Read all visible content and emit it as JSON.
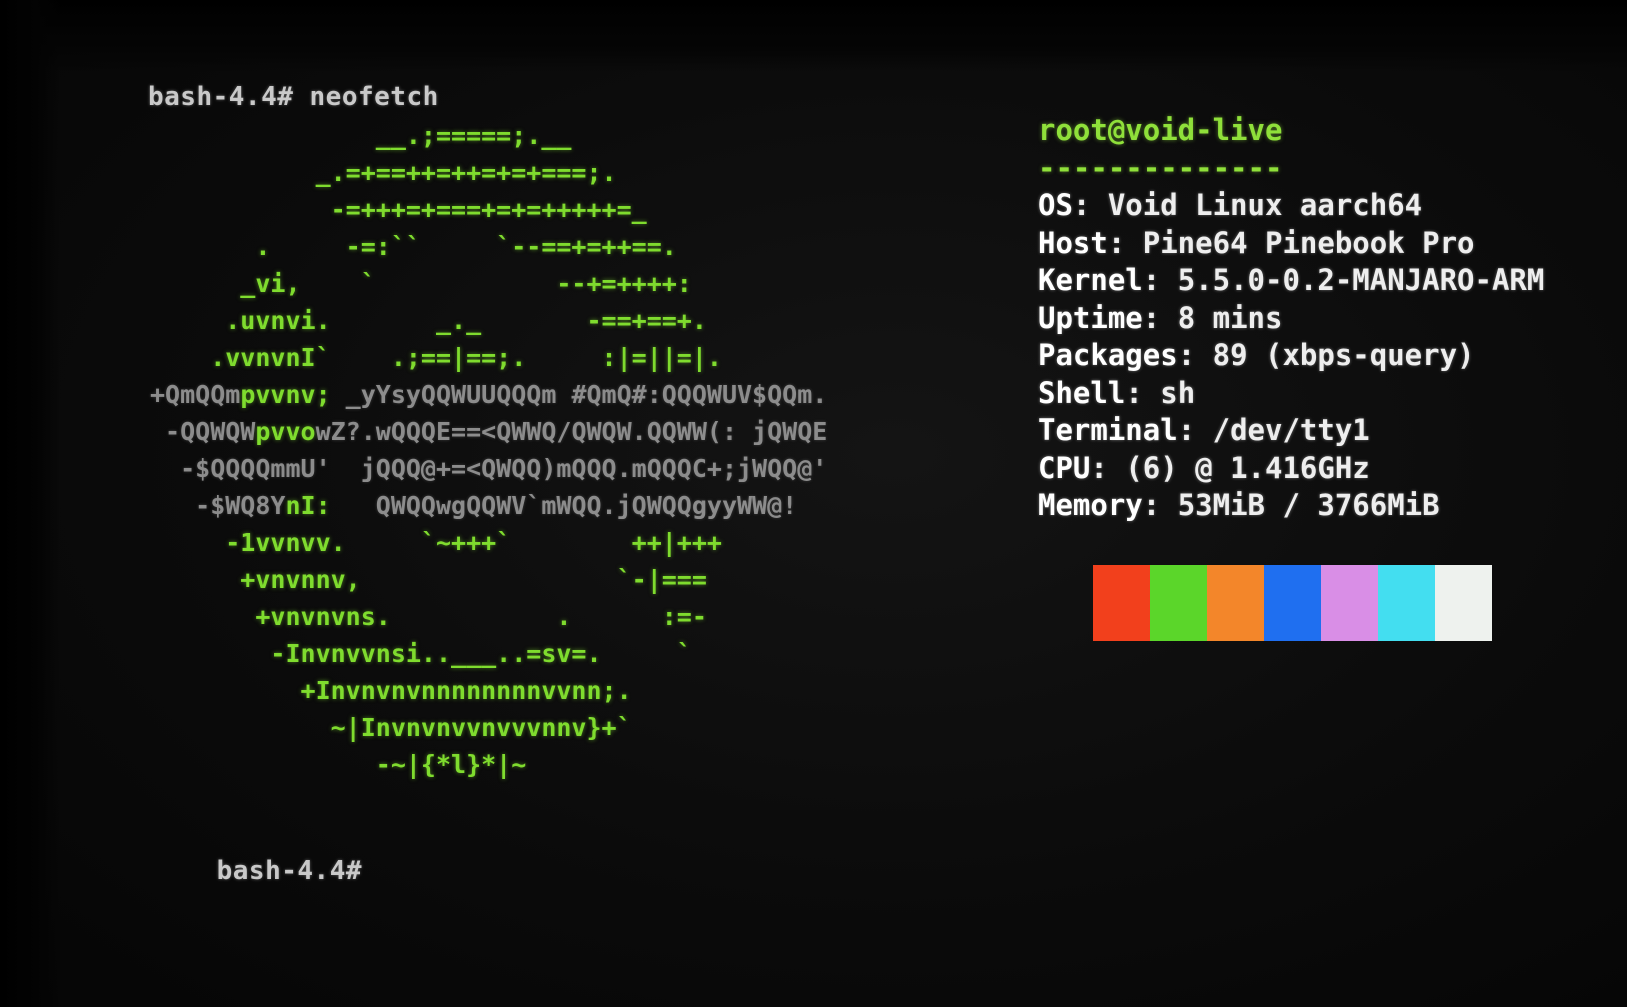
{
  "terminal": {
    "prompt_command": "bash-4.4# neofetch",
    "prompt_idle": "bash-4.4#"
  },
  "logo": {
    "lines": [
      [
        {
          "t": "               __.;=====;.__",
          "d": false
        }
      ],
      [
        {
          "t": "           _.=+==++=++=+=+===;.",
          "d": false
        }
      ],
      [
        {
          "t": "            -=+++=+===+=+=+++++=_",
          "d": false
        }
      ],
      [
        {
          "t": "       .     -=:``     `--==+=++==.",
          "d": false
        }
      ],
      [
        {
          "t": "      _vi,    `            --+=++++:",
          "d": false
        }
      ],
      [
        {
          "t": "     .uvnvi.       _._       -==+==+.",
          "d": false
        }
      ],
      [
        {
          "t": "    .vvnvnI`    .;==|==;.     :|=||=|.",
          "d": false
        }
      ],
      [
        {
          "t": "+QmQQm",
          "d": true
        },
        {
          "t": "pvvnv;",
          "d": false
        },
        {
          "t": " _yYsyQQWUUQQQm #QmQ#:QQQWUV$QQm.",
          "d": true
        }
      ],
      [
        {
          "t": " -QQWQW",
          "d": true
        },
        {
          "t": "pvvo",
          "d": false
        },
        {
          "t": "wZ?.wQQQE==<QWWQ/QWQW.QQWW(: jQWQE",
          "d": true
        }
      ],
      [
        {
          "t": "  -$QQQQmmU'  jQQQ@+=<QWQQ)mQQQ.mQQQC+;jWQQ@'",
          "d": true
        }
      ],
      [
        {
          "t": "   -$WQ8Y",
          "d": true
        },
        {
          "t": "nI:",
          "d": false
        },
        {
          "t": "   QWQQwgQQWV`mWQQ.jQWQQgyyWW@!",
          "d": true
        }
      ],
      [
        {
          "t": "     -1vvnvv.     `~+++`        ++|+++",
          "d": false
        }
      ],
      [
        {
          "t": "      +vnvnnv,                 `-|===",
          "d": false
        }
      ],
      [
        {
          "t": "       +vnvnvns.           .      :=-",
          "d": false
        }
      ],
      [
        {
          "t": "        -Invnvvnsi..___..=sv=.     `",
          "d": false
        }
      ],
      [
        {
          "t": "          +Invnvnvnnnnnnnnvvnn;.",
          "d": false
        }
      ],
      [
        {
          "t": "            ~|Invnvnvvnvvvnnv}+`",
          "d": false
        }
      ],
      [
        {
          "t": "               -~|{*l}*|~",
          "d": false
        }
      ]
    ]
  },
  "info": {
    "title": "root@void-live",
    "separator": "--------------",
    "items": [
      {
        "key": "OS",
        "value": "Void Linux aarch64"
      },
      {
        "key": "Host",
        "value": "Pine64 Pinebook Pro"
      },
      {
        "key": "Kernel",
        "value": "5.5.0-0.2-MANJARO-ARM"
      },
      {
        "key": "Uptime",
        "value": "8 mins"
      },
      {
        "key": "Packages",
        "value": "89 (xbps-query)"
      },
      {
        "key": "Shell",
        "value": "sh"
      },
      {
        "key": "Terminal",
        "value": "/dev/tty1"
      },
      {
        "key": "CPU",
        "value": "(6) @ 1.416GHz"
      },
      {
        "key": "Memory",
        "value": "53MiB / 3766MiB"
      }
    ]
  },
  "palette": {
    "colors": [
      "#f2401c",
      "#5bd62a",
      "#f3862a",
      "#1f6ff0",
      "#d98ee6",
      "#43def0",
      "#eef2ee"
    ]
  }
}
